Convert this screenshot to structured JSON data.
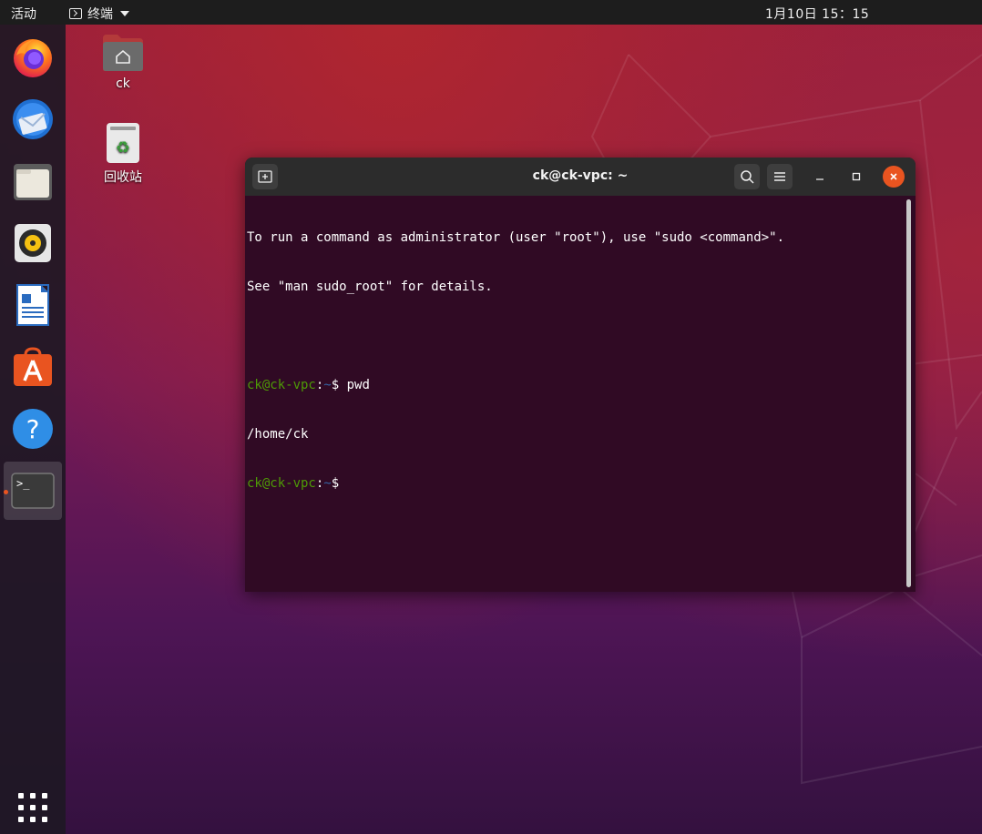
{
  "topbar": {
    "activities": "活动",
    "app_name": "终端",
    "clock": "1月10日  15：15"
  },
  "dock": {
    "items": [
      {
        "name": "Firefox"
      },
      {
        "name": "Thunderbird"
      },
      {
        "name": "文件"
      },
      {
        "name": "Rhythmbox"
      },
      {
        "name": "LibreOffice Writer"
      },
      {
        "name": "Ubuntu Software"
      },
      {
        "name": "帮助"
      },
      {
        "name": "终端"
      }
    ]
  },
  "desktop": {
    "home_label": "ck",
    "trash_label": "回收站"
  },
  "terminal": {
    "title": "ck@ck-vpc: ~",
    "lines": {
      "l1": "To run a command as administrator (user \"root\"), use \"sudo <command>\".",
      "l2": "See \"man sudo_root\" for details.",
      "l4_user": "ck@ck-vpc",
      "l4_colon": ":",
      "l4_path": "~",
      "l4_cmd": "$ pwd",
      "l5": "/home/ck",
      "l6_user": "ck@ck-vpc",
      "l6_colon": ":",
      "l6_path": "~",
      "l6_cmd": "$ "
    }
  },
  "colors": {
    "terminal_bg": "#300a24",
    "prompt_user": "#4e9a06",
    "prompt_path": "#3465a4",
    "accent": "#e95420"
  }
}
